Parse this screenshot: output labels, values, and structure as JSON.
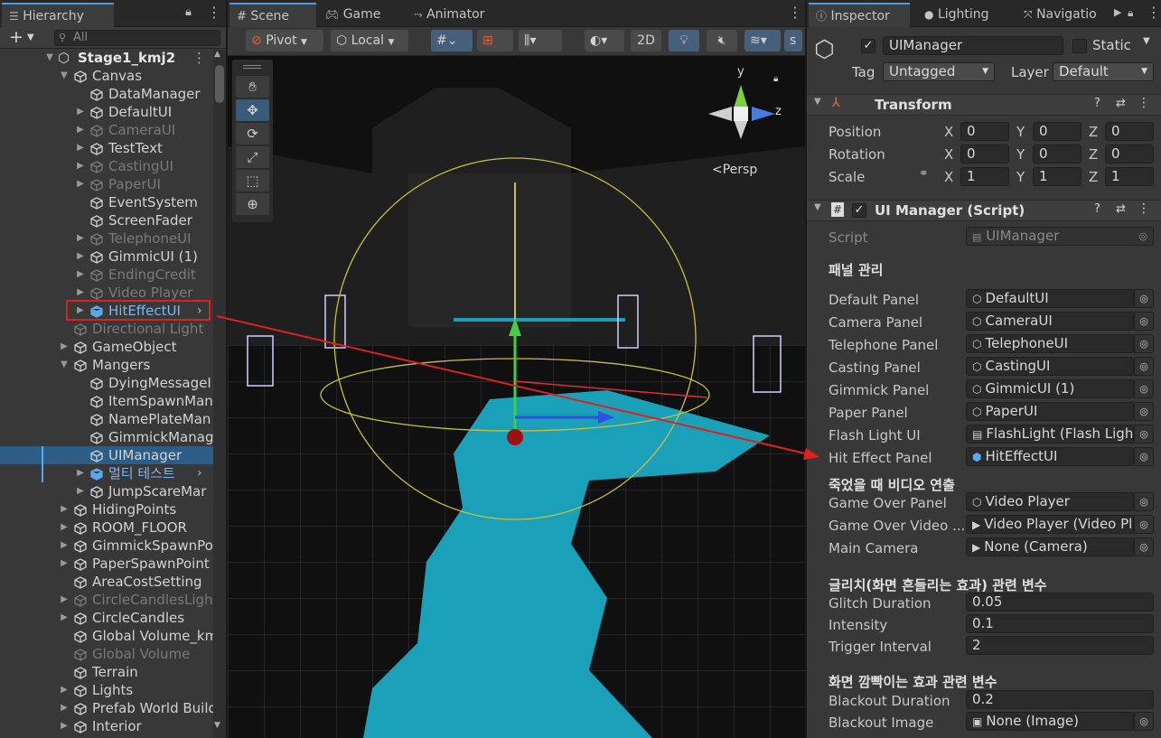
{
  "hierarchy": {
    "tab_label": "Hierarchy",
    "search_placeholder": "All",
    "scene_name": "Stage1_kmj2",
    "rows": [
      {
        "label": "Canvas",
        "indent": 1,
        "arrow": "open",
        "state": "normal"
      },
      {
        "label": "DataManager",
        "indent": 2,
        "arrow": "none",
        "state": "normal"
      },
      {
        "label": "DefaultUI",
        "indent": 2,
        "arrow": "closed",
        "state": "normal"
      },
      {
        "label": "CameraUI",
        "indent": 2,
        "arrow": "closed",
        "state": "dim"
      },
      {
        "label": "TestText",
        "indent": 2,
        "arrow": "closed",
        "state": "normal"
      },
      {
        "label": "CastingUI",
        "indent": 2,
        "arrow": "closed",
        "state": "dim"
      },
      {
        "label": "PaperUI",
        "indent": 2,
        "arrow": "closed",
        "state": "dim"
      },
      {
        "label": "EventSystem",
        "indent": 2,
        "arrow": "none",
        "state": "normal"
      },
      {
        "label": "ScreenFader",
        "indent": 2,
        "arrow": "none",
        "state": "normal"
      },
      {
        "label": "TelephoneUI",
        "indent": 2,
        "arrow": "closed",
        "state": "dim"
      },
      {
        "label": "GimmicUI (1)",
        "indent": 2,
        "arrow": "closed",
        "state": "normal"
      },
      {
        "label": "EndingCredit",
        "indent": 2,
        "arrow": "closed",
        "state": "dim"
      },
      {
        "label": "Video Player",
        "indent": 2,
        "arrow": "closed",
        "state": "dim"
      },
      {
        "label": "HitEffectUI",
        "indent": 2,
        "arrow": "closed",
        "state": "prefab-highlight"
      },
      {
        "label": "Directional Light",
        "indent": 1,
        "arrow": "none",
        "state": "dim"
      },
      {
        "label": "GameObject",
        "indent": 1,
        "arrow": "closed",
        "state": "normal"
      },
      {
        "label": "Mangers",
        "indent": 1,
        "arrow": "open",
        "state": "normal"
      },
      {
        "label": "DyingMessageI",
        "indent": 2,
        "arrow": "none",
        "state": "normal"
      },
      {
        "label": "ItemSpawnMan",
        "indent": 2,
        "arrow": "none",
        "state": "normal"
      },
      {
        "label": "NamePlateMan",
        "indent": 2,
        "arrow": "none",
        "state": "normal"
      },
      {
        "label": "GimmickManag",
        "indent": 2,
        "arrow": "none",
        "state": "normal"
      },
      {
        "label": "UIManager",
        "indent": 2,
        "arrow": "none",
        "state": "selected"
      },
      {
        "label": "멀티 테스트",
        "indent": 2,
        "arrow": "closed",
        "state": "prefab"
      },
      {
        "label": "JumpScareMar",
        "indent": 2,
        "arrow": "closed",
        "state": "normal"
      },
      {
        "label": "HidingPoints",
        "indent": 1,
        "arrow": "closed",
        "state": "normal"
      },
      {
        "label": "ROOM_FLOOR",
        "indent": 1,
        "arrow": "closed",
        "state": "normal"
      },
      {
        "label": "GimmickSpawnPo",
        "indent": 1,
        "arrow": "closed",
        "state": "normal"
      },
      {
        "label": "PaperSpawnPoint",
        "indent": 1,
        "arrow": "closed",
        "state": "normal"
      },
      {
        "label": "AreaCostSetting",
        "indent": 1,
        "arrow": "none",
        "state": "normal"
      },
      {
        "label": "CircleCandlesLigh",
        "indent": 1,
        "arrow": "closed",
        "state": "dim"
      },
      {
        "label": "CircleCandles",
        "indent": 1,
        "arrow": "closed",
        "state": "normal"
      },
      {
        "label": "Global Volume_km",
        "indent": 1,
        "arrow": "none",
        "state": "normal"
      },
      {
        "label": "Global Volume",
        "indent": 1,
        "arrow": "none",
        "state": "dim"
      },
      {
        "label": "Terrain",
        "indent": 1,
        "arrow": "none",
        "state": "normal"
      },
      {
        "label": "Lights",
        "indent": 1,
        "arrow": "closed",
        "state": "normal"
      },
      {
        "label": "Prefab World Build",
        "indent": 1,
        "arrow": "closed",
        "state": "normal"
      },
      {
        "label": "Interior",
        "indent": 1,
        "arrow": "closed",
        "state": "normal"
      }
    ]
  },
  "scene": {
    "tabs": [
      "Scene",
      "Game",
      "Animator"
    ],
    "pivot": "Pivot",
    "local": "Local",
    "mode_2d": "2D",
    "persp": "<Persp",
    "gizmo_y": "y",
    "gizmo_z": "z"
  },
  "inspector": {
    "tabs": [
      "Inspector",
      "Lighting",
      "Navigatio"
    ],
    "object_name": "UIManager",
    "static_label": "Static",
    "tag_label": "Tag",
    "tag_value": "Untagged",
    "layer_label": "Layer",
    "layer_value": "Default",
    "transform": {
      "title": "Transform",
      "rows": [
        {
          "label": "Position",
          "x": "0",
          "y": "0",
          "z": "0"
        },
        {
          "label": "Rotation",
          "x": "0",
          "y": "0",
          "z": "0"
        },
        {
          "label": "Scale",
          "x": "1",
          "y": "1",
          "z": "1"
        }
      ]
    },
    "script_comp": {
      "title": "UI Manager (Script)",
      "script_label": "Script",
      "script_value": "UIManager"
    },
    "section1": {
      "header": "패널 관리",
      "rows": [
        {
          "label": "Default Panel",
          "value": "DefaultUI",
          "icon": "cube"
        },
        {
          "label": "Camera Panel",
          "value": "CameraUI",
          "icon": "cube"
        },
        {
          "label": "Telephone Panel",
          "value": "TelephoneUI",
          "icon": "cube"
        },
        {
          "label": "Casting Panel",
          "value": "CastingUI",
          "icon": "cube"
        },
        {
          "label": "Gimmick Panel",
          "value": "GimmicUI (1)",
          "icon": "cube"
        },
        {
          "label": "Paper Panel",
          "value": "PaperUI",
          "icon": "cube"
        },
        {
          "label": "Flash Light UI",
          "value": "FlashLight (Flash Light",
          "icon": "script"
        },
        {
          "label": "Hit Effect Panel",
          "value": "HitEffectUI",
          "icon": "prefab"
        }
      ]
    },
    "section2": {
      "header": "죽었을 때 비디오 연출",
      "rows": [
        {
          "label": "Game Over Panel",
          "value": "Video Player",
          "icon": "cube"
        },
        {
          "label": "Game Over Video ...",
          "value": "Video Player (Video Pla",
          "icon": "video"
        },
        {
          "label": "Main Camera",
          "value": "None (Camera)",
          "icon": "video"
        }
      ]
    },
    "section3": {
      "header": "글리치(화면 흔들리는 효과) 관련 변수",
      "rows": [
        {
          "label": "Glitch Duration",
          "value": "0.05"
        },
        {
          "label": "Intensity",
          "value": "0.1"
        },
        {
          "label": "Trigger Interval",
          "value": "2"
        }
      ]
    },
    "section4": {
      "header": "화면 깜빡이는 효과 관련 변수",
      "rows": [
        {
          "label": "Blackout Duration",
          "value": "0.2"
        },
        {
          "label": "Blackout Image",
          "value": "None (Image)",
          "icon": "image"
        }
      ]
    }
  },
  "colors": {
    "selection": "#2c5d87",
    "prefab": "#7cb8f0",
    "annotation": "#e02020",
    "accent": "#4d9de0"
  }
}
